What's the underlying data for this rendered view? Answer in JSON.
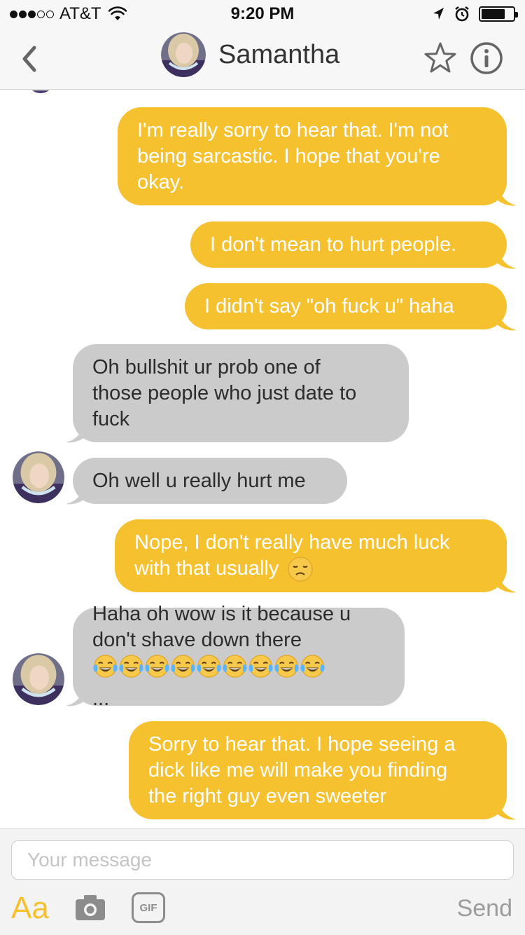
{
  "status_bar": {
    "carrier": "AT&T",
    "time": "9:20 PM",
    "signal_bars_filled": 3,
    "signal_bars_total": 5,
    "battery_level": 0.75
  },
  "header": {
    "contact_name": "Samantha",
    "back_icon": "chevron-left-icon",
    "favorite_icon": "star-icon",
    "info_icon": "info-icon"
  },
  "messages": [
    {
      "dir": "out",
      "lines": [
        "I'm really sorry to hear that. I'm not",
        "being sarcastic. I hope that you're",
        "okay."
      ]
    },
    {
      "dir": "out",
      "lines": [
        "I don't mean to hurt people."
      ]
    },
    {
      "dir": "out",
      "lines": [
        "I didn't say \"oh fuck u\" haha"
      ]
    },
    {
      "dir": "in",
      "lines": [
        "Oh bullshit ur prob one of",
        "those people who just date to",
        "fuck"
      ]
    },
    {
      "dir": "in",
      "lines": [
        "Oh well u really hurt me"
      ]
    },
    {
      "dir": "out",
      "lines": [
        "Nope, I don't really have much luck",
        "with that usually"
      ],
      "trailing_emoji": "disappointed-face"
    },
    {
      "dir": "in",
      "lines": [
        "Haha oh wow is it because u",
        "don't shave down there"
      ],
      "emoji_line": {
        "emoji": "face-with-tears-of-joy",
        "count": 9,
        "suffix": "..."
      }
    },
    {
      "dir": "out",
      "lines": [
        "Sorry to hear that. I hope seeing a",
        "dick like me will make you finding",
        "the right guy even sweeter"
      ]
    }
  ],
  "composer": {
    "placeholder": "Your message",
    "value": "",
    "format_label": "Aa",
    "gif_label": "GIF",
    "send_label": "Send"
  },
  "colors": {
    "outgoing_bubble": "#f5c12e",
    "incoming_bubble": "#cbcbcb",
    "accent": "#f5c12e"
  }
}
